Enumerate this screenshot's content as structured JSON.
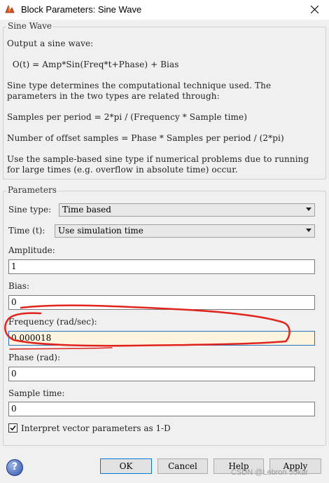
{
  "window": {
    "title": "Block Parameters: Sine Wave"
  },
  "description": {
    "group_title": "Sine Wave",
    "lines": [
      "Output a sine wave:",
      "  O(t) = Amp*Sin(Freq*t+Phase) + Bias",
      "Sine type determines the computational technique used. The",
      "parameters in the two types are related through:",
      "Samples per period = 2*pi / (Frequency * Sample time)",
      "Number of offset samples = Phase * Samples per period / (2*pi)",
      "Use the sample-based sine type if numerical problems due to running",
      "for large times (e.g. overflow in absolute time) occur."
    ]
  },
  "parameters": {
    "group_title": "Parameters",
    "sine_type": {
      "label": "Sine type:",
      "value": "Time based"
    },
    "time": {
      "label": "Time (t):",
      "value": "Use simulation time"
    },
    "amplitude": {
      "label": "Amplitude:",
      "value": "1"
    },
    "bias": {
      "label": "Bias:",
      "value": "0"
    },
    "frequency": {
      "label": "Frequency (rad/sec):",
      "value": "0.000018"
    },
    "phase": {
      "label": "Phase (rad):",
      "value": "0"
    },
    "sample_time": {
      "label": "Sample time:",
      "value": "0"
    },
    "interpret_vector": {
      "label": "Interpret vector parameters as 1-D",
      "checked": true
    }
  },
  "buttons": {
    "ok": "OK",
    "cancel": "Cancel",
    "help": "Help",
    "apply": "Apply"
  },
  "watermark": "CSDN @Lebron 55kar",
  "colors": {
    "annotation": "#e0241c",
    "focus_border": "#2b6fbf",
    "focus_bg": "#fdf4e0"
  }
}
